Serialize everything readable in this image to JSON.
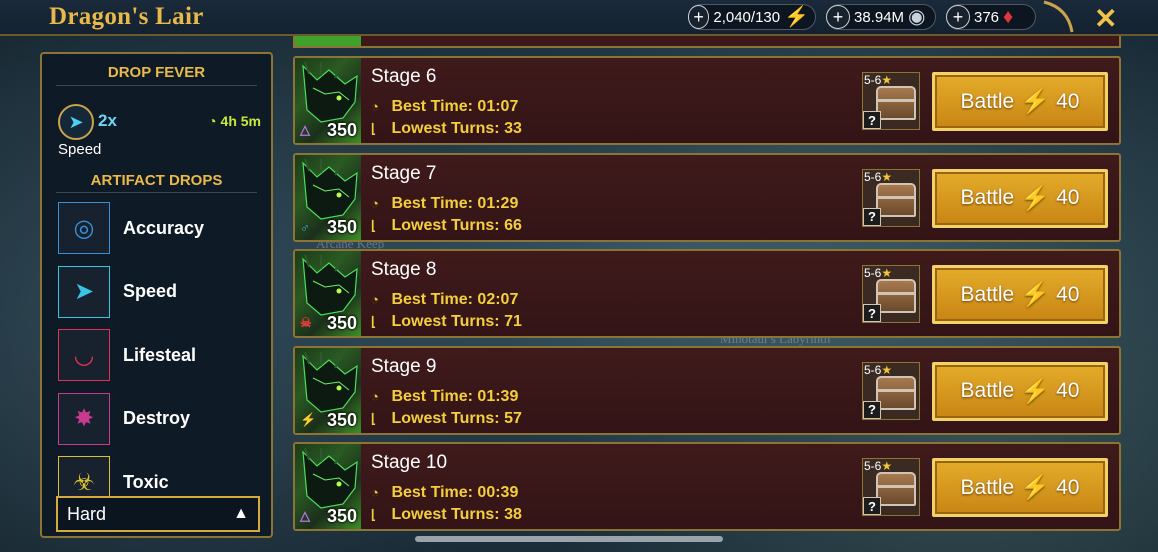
{
  "header": {
    "title": "Dragon's Lair",
    "energy": "2,040/130",
    "silver": "38.94M",
    "gems": "376"
  },
  "left_panel": {
    "drop_fever": {
      "heading": "DROP FEVER",
      "multiplier": "2x",
      "timer": "4h 5m",
      "stat": "Speed"
    },
    "artifact_drops": {
      "heading": "ARTIFACT DROPS",
      "items": [
        {
          "label": "Accuracy",
          "icon": "accuracy-icon",
          "color": "#3a8fd8",
          "glyph": "◎"
        },
        {
          "label": "Speed",
          "icon": "speed-icon",
          "color": "#39c4e6",
          "glyph": "➤"
        },
        {
          "label": "Lifesteal",
          "icon": "lifesteal-icon",
          "color": "#e0305a",
          "glyph": "◡"
        },
        {
          "label": "Destroy",
          "icon": "destroy-icon",
          "color": "#c73a8e",
          "glyph": "✸"
        },
        {
          "label": "Toxic",
          "icon": "toxic-icon",
          "color": "#d8c232",
          "glyph": "☣"
        }
      ]
    },
    "difficulty": "Hard"
  },
  "stages": [
    {
      "name": "Stage 6",
      "best_time_label": "Best Time:",
      "best_time": "01:07",
      "lowest_turns_label": "Lowest Turns:",
      "lowest_turns": "33",
      "level": "350",
      "affinity": "magic",
      "affinity_color": "#c070e8",
      "affinity_glyph": "△",
      "loot_stars": "5-6",
      "battle_label": "Battle",
      "energy_cost": "40"
    },
    {
      "name": "Stage 7",
      "best_time_label": "Best Time:",
      "best_time": "01:29",
      "lowest_turns_label": "Lowest Turns:",
      "lowest_turns": "66",
      "level": "350",
      "affinity": "void",
      "affinity_color": "#4aa8e8",
      "affinity_glyph": "♂",
      "loot_stars": "5-6",
      "battle_label": "Battle",
      "energy_cost": "40"
    },
    {
      "name": "Stage 8",
      "best_time_label": "Best Time:",
      "best_time": "02:07",
      "lowest_turns_label": "Lowest Turns:",
      "lowest_turns": "71",
      "level": "350",
      "affinity": "force",
      "affinity_color": "#e83a3a",
      "affinity_glyph": "☠",
      "loot_stars": "5-6",
      "battle_label": "Battle",
      "energy_cost": "40"
    },
    {
      "name": "Stage 9",
      "best_time_label": "Best Time:",
      "best_time": "01:39",
      "lowest_turns_label": "Lowest Turns:",
      "lowest_turns": "57",
      "level": "350",
      "affinity": "spirit",
      "affinity_color": "#5ad04a",
      "affinity_glyph": "⚡",
      "loot_stars": "5-6",
      "battle_label": "Battle",
      "energy_cost": "40"
    },
    {
      "name": "Stage 10",
      "best_time_label": "Best Time:",
      "best_time": "00:39",
      "lowest_turns_label": "Lowest Turns:",
      "lowest_turns": "38",
      "level": "350",
      "affinity": "magic",
      "affinity_color": "#c070e8",
      "affinity_glyph": "△",
      "loot_stars": "5-6",
      "battle_label": "Battle",
      "energy_cost": "40"
    }
  ],
  "colors": {
    "accent_gold": "#e9b94a",
    "stat_yellow": "#f4cf3c",
    "energy_green": "#c6ea3a",
    "panel_border": "#8c7434",
    "stage_bg": "#3f1a1b"
  }
}
